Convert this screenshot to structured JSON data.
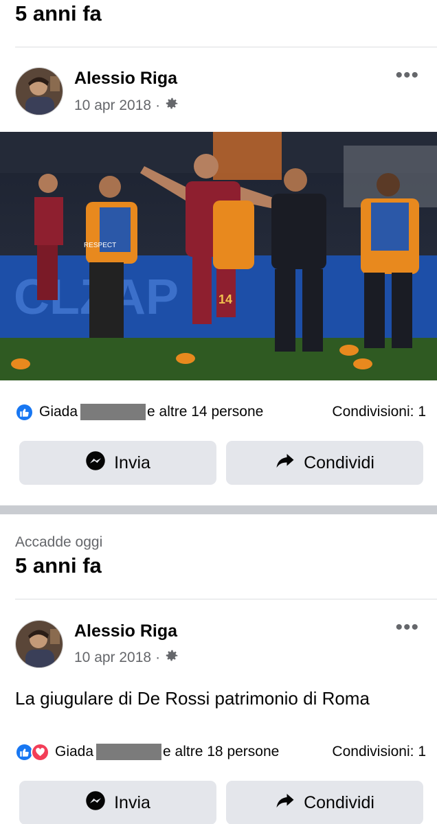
{
  "top": {
    "title": "5 anni fa"
  },
  "post1": {
    "author": "Alessio Riga",
    "date": "10 apr 2018",
    "separator": "·",
    "liker": "Giada",
    "likes_rest": "e altre 14 persone",
    "shares": "Condivisioni: 1",
    "send_label": "Invia",
    "share_label": "Condividi",
    "photo_text": {
      "ad_board": "CLZAP",
      "badge_respect": "RESPECT",
      "shirt_number": "14"
    }
  },
  "memory": {
    "subtitle": "Accadde oggi",
    "title": "5 anni fa"
  },
  "post2": {
    "author": "Alessio Riga",
    "date": "10 apr 2018",
    "separator": "·",
    "text": "La giugulare di De Rossi patrimonio di Roma",
    "liker": "Giada",
    "likes_rest": "e altre 18 persone",
    "shares": "Condivisioni: 1",
    "send_label": "Invia",
    "share_label": "Condividi"
  },
  "colors": {
    "like": "#1877f2",
    "love": "#f33e58",
    "button_bg": "#e4e6eb",
    "roma_red": "#8e1f2f",
    "roma_orange": "#e8891e"
  },
  "icons": [
    "more-icon",
    "gear-icon",
    "like-icon",
    "love-icon",
    "messenger-icon",
    "share-arrow-icon"
  ]
}
